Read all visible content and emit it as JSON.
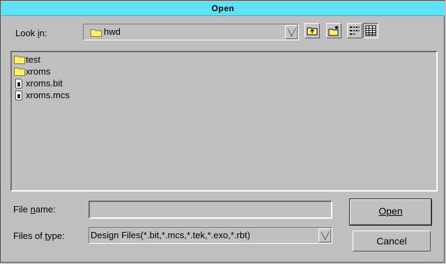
{
  "window": {
    "title": "Open"
  },
  "look_in": {
    "label": "Look in:",
    "value": "hwd"
  },
  "toolbar": {
    "icons": [
      "up-folder-icon",
      "new-folder-icon",
      "list-view-icon",
      "details-view-icon"
    ]
  },
  "files": [
    {
      "name": "test",
      "type": "folder"
    },
    {
      "name": "xroms",
      "type": "folder"
    },
    {
      "name": "xroms.bit",
      "type": "file"
    },
    {
      "name": "xroms.mcs",
      "type": "file"
    }
  ],
  "file_name": {
    "label": "File name:",
    "value": ""
  },
  "files_of_type": {
    "label": "Files of type:",
    "value": "Design Files(*.bit,*.mcs,*.tek,*.exo,*.rbt)"
  },
  "buttons": {
    "open": "Open",
    "cancel": "Cancel"
  },
  "colors": {
    "titlebar": "#5fe0f4",
    "background": "#c0c0c0",
    "folder": "#ffef7a"
  }
}
